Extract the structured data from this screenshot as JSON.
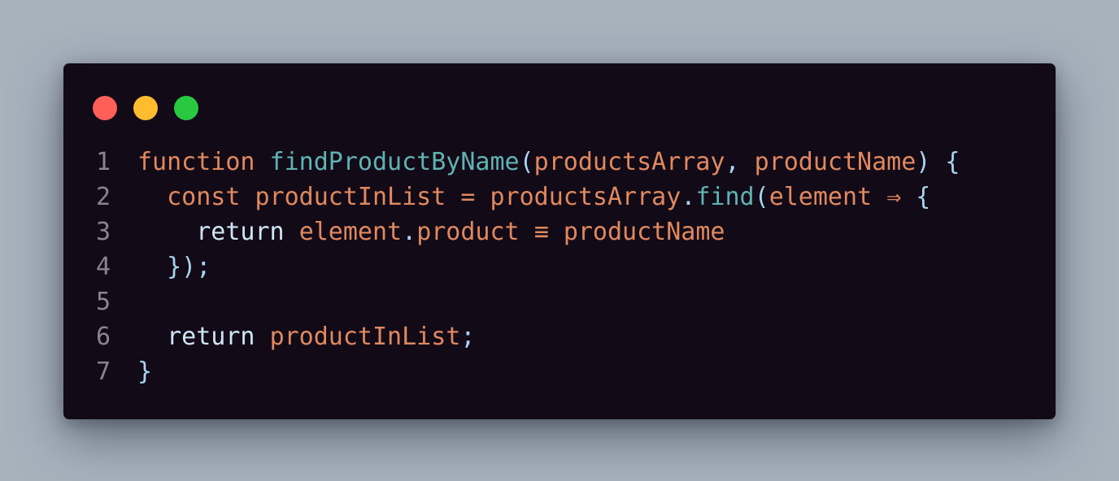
{
  "colors": {
    "background": "#a7b2bd",
    "editor_background": "#130a18",
    "line_number": "#8a8490",
    "keyword": "#e0895f",
    "function_name": "#5fb3b3",
    "identifier": "#e0895f",
    "punctuation": "#a9d4ee",
    "return_keyword": "#cfe6f5",
    "dot_red": "#ff5f57",
    "dot_yellow": "#febc2e",
    "dot_green": "#28c840"
  },
  "window_controls": [
    {
      "name": "close",
      "color": "#ff5f57"
    },
    {
      "name": "minimize",
      "color": "#febc2e"
    },
    {
      "name": "maximize",
      "color": "#28c840"
    }
  ],
  "code": {
    "lines": [
      {
        "number": "1",
        "tokens": [
          {
            "text": "function",
            "color": "#e0895f"
          },
          {
            "text": " ",
            "color": "#a9d4ee"
          },
          {
            "text": "findProductByName",
            "color": "#5fb3b3"
          },
          {
            "text": "(",
            "color": "#a9d4ee"
          },
          {
            "text": "productsArray",
            "color": "#e0895f"
          },
          {
            "text": ", ",
            "color": "#a9d4ee"
          },
          {
            "text": "productName",
            "color": "#e0895f"
          },
          {
            "text": ") {",
            "color": "#a9d4ee"
          }
        ]
      },
      {
        "number": "2",
        "tokens": [
          {
            "text": "  ",
            "color": "#a9d4ee"
          },
          {
            "text": "const",
            "color": "#e0895f"
          },
          {
            "text": " ",
            "color": "#a9d4ee"
          },
          {
            "text": "productInList",
            "color": "#e0895f"
          },
          {
            "text": " ",
            "color": "#a9d4ee"
          },
          {
            "text": "=",
            "color": "#e0895f"
          },
          {
            "text": " ",
            "color": "#a9d4ee"
          },
          {
            "text": "productsArray",
            "color": "#e0895f"
          },
          {
            "text": ".",
            "color": "#a9d4ee"
          },
          {
            "text": "find",
            "color": "#5fb3b3"
          },
          {
            "text": "(",
            "color": "#a9d4ee"
          },
          {
            "text": "element",
            "color": "#e0895f"
          },
          {
            "text": " ",
            "color": "#a9d4ee"
          },
          {
            "text": "⇒",
            "color": "#e0895f"
          },
          {
            "text": " {",
            "color": "#a9d4ee"
          }
        ]
      },
      {
        "number": "3",
        "tokens": [
          {
            "text": "    ",
            "color": "#a9d4ee"
          },
          {
            "text": "return",
            "color": "#cfe6f5"
          },
          {
            "text": " ",
            "color": "#a9d4ee"
          },
          {
            "text": "element",
            "color": "#e0895f"
          },
          {
            "text": ".",
            "color": "#a9d4ee"
          },
          {
            "text": "product",
            "color": "#e0895f"
          },
          {
            "text": " ",
            "color": "#a9d4ee"
          },
          {
            "text": "≡",
            "color": "#e0895f"
          },
          {
            "text": " ",
            "color": "#a9d4ee"
          },
          {
            "text": "productName",
            "color": "#e0895f"
          }
        ]
      },
      {
        "number": "4",
        "tokens": [
          {
            "text": "  ",
            "color": "#a9d4ee"
          },
          {
            "text": "});",
            "color": "#a9d4ee"
          }
        ]
      },
      {
        "number": "5",
        "tokens": []
      },
      {
        "number": "6",
        "tokens": [
          {
            "text": "  ",
            "color": "#a9d4ee"
          },
          {
            "text": "return",
            "color": "#cfe6f5"
          },
          {
            "text": " ",
            "color": "#a9d4ee"
          },
          {
            "text": "productInList",
            "color": "#e0895f"
          },
          {
            "text": ";",
            "color": "#a9d4ee"
          }
        ]
      },
      {
        "number": "7",
        "tokens": [
          {
            "text": "}",
            "color": "#a9d4ee"
          }
        ]
      }
    ]
  }
}
